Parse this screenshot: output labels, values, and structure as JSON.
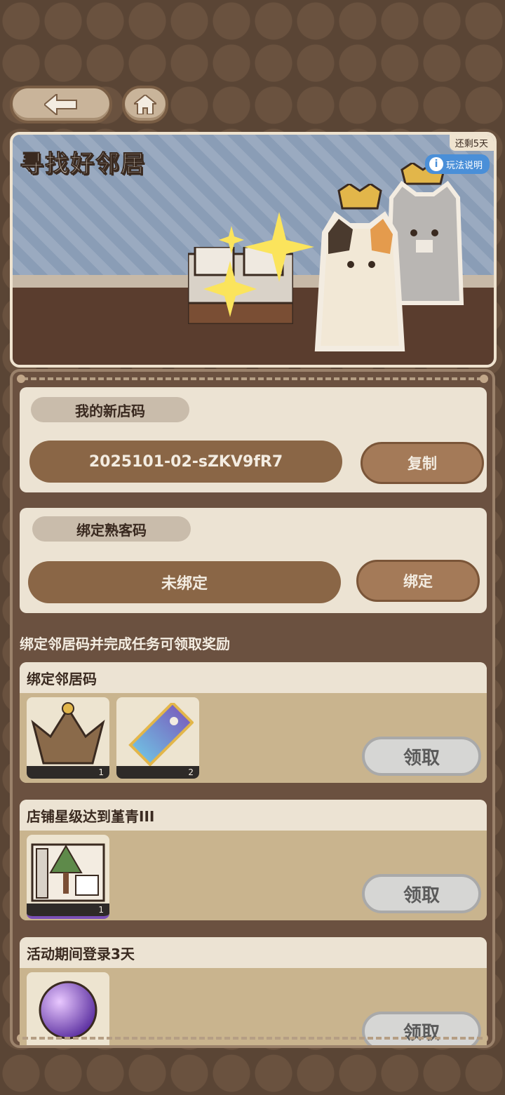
{
  "nav": {
    "back_icon": "left-arrow-icon",
    "home_icon": "home-icon"
  },
  "banner": {
    "title": "寻找好邻居",
    "days_left": "还剩5天",
    "rules_label": "玩法说明"
  },
  "my_code": {
    "label": "我的新店码",
    "value": "2025101-02-sZKV9fR7",
    "copy_label": "复制"
  },
  "bind_code": {
    "label": "绑定熟客码",
    "value": "未绑定",
    "bind_label": "绑定"
  },
  "rewards_heading": "绑定邻居码并完成任务可领取奖励",
  "tasks": [
    {
      "title": "绑定邻居码",
      "items": [
        {
          "icon": "crown-icon",
          "qty": "1"
        },
        {
          "icon": "ticket-icon",
          "qty": "2"
        }
      ],
      "claim_label": "领取"
    },
    {
      "title": "店铺星级达到堇青III",
      "items": [
        {
          "icon": "furniture-set-icon",
          "qty": "1"
        }
      ],
      "claim_label": "领取"
    },
    {
      "title": "活动期间登录3天",
      "items": [
        {
          "icon": "crystal-orb-icon",
          "qty": ""
        }
      ],
      "claim_label": "领取"
    }
  ]
}
